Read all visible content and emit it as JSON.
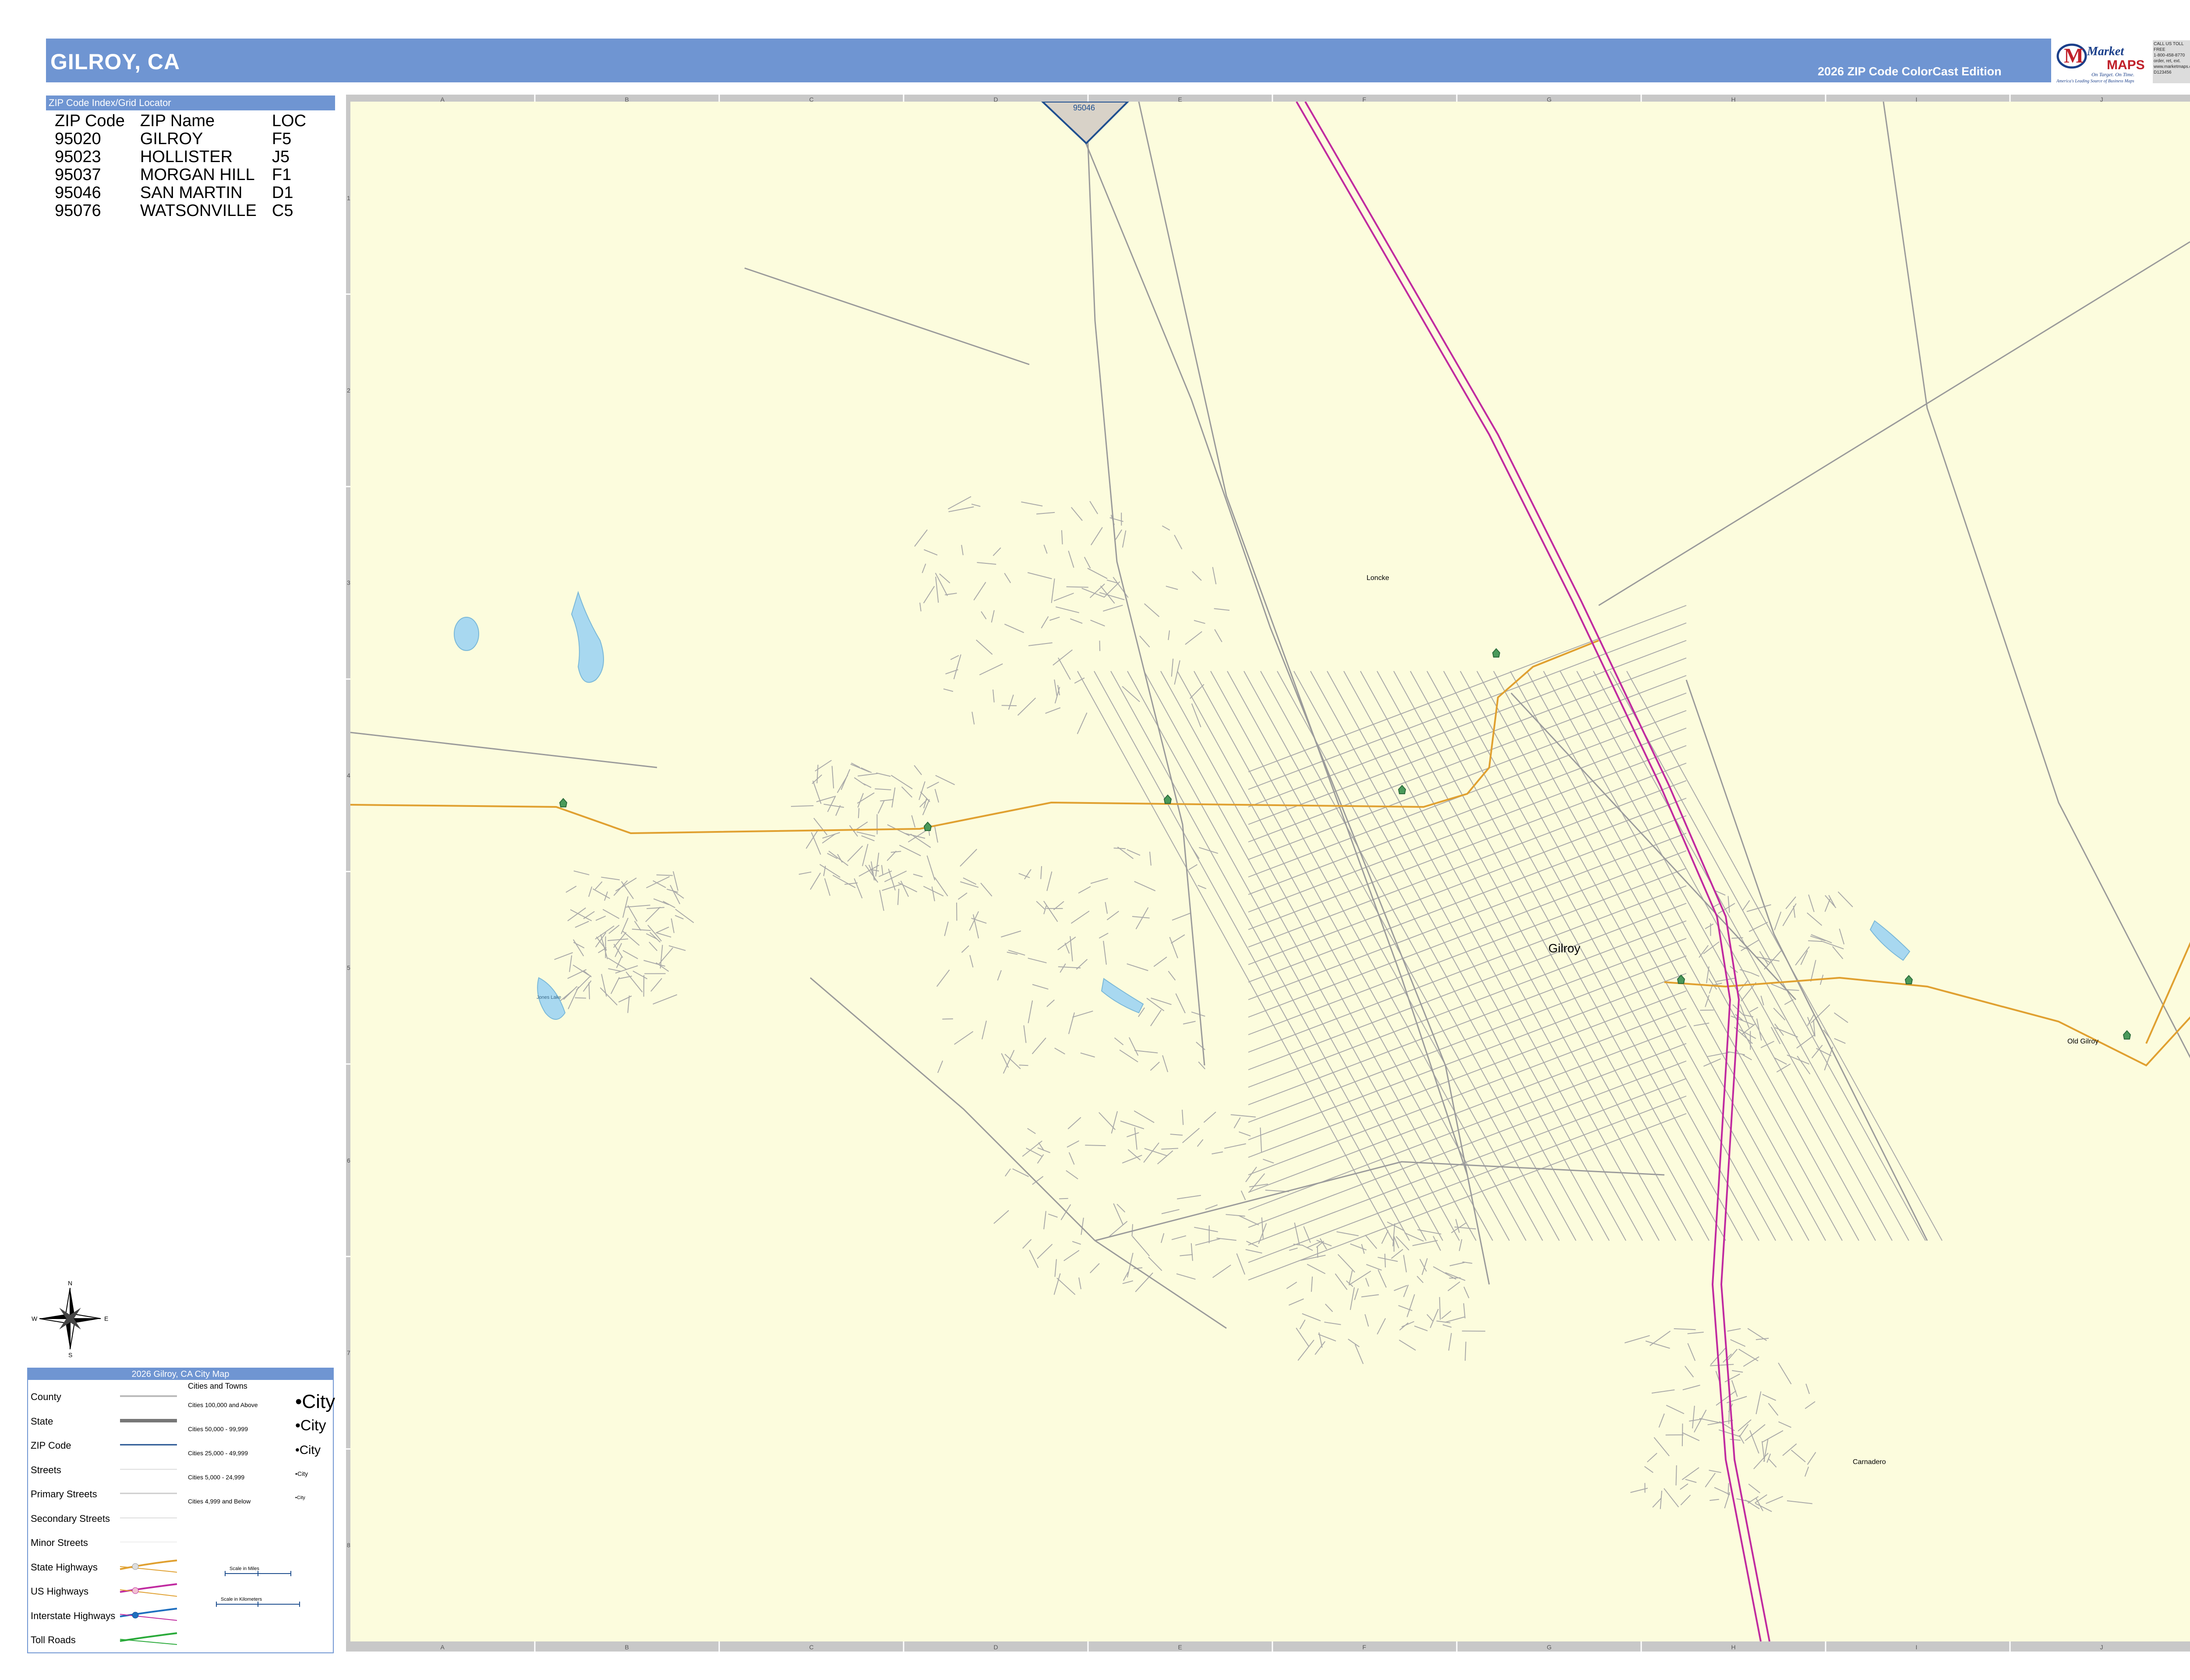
{
  "header": {
    "title": "GILROY, CA",
    "edition": "2026 ZIP Code ColorCast Edition",
    "logo_word": "Market",
    "logo_maps": "MAPS",
    "logo_tagline": "On Target. On Time.",
    "logo_subtagline": "America's Leading Source of Business Maps",
    "badge_lines": [
      "CALL US TOLL FREE",
      "1-800-458-8770",
      "order, ret, ext.",
      "www.marketmaps.com",
      "D123456"
    ]
  },
  "zip_index": {
    "header": "ZIP Code Index/Grid Locator",
    "columns": [
      "ZIP Code",
      "ZIP Name",
      "LOC"
    ],
    "rows": [
      [
        "95020",
        "GILROY",
        "F5"
      ],
      [
        "95023",
        "HOLLISTER",
        "J5"
      ],
      [
        "95037",
        "MORGAN HILL",
        "F1"
      ],
      [
        "95046",
        "SAN MARTIN",
        "D1"
      ],
      [
        "95076",
        "WATSONVILLE",
        "C5"
      ]
    ]
  },
  "map": {
    "grid_columns": [
      "A",
      "B",
      "C",
      "D",
      "E",
      "F",
      "G",
      "H",
      "I",
      "J"
    ],
    "grid_rows": [
      "1",
      "2",
      "3",
      "4",
      "5",
      "6",
      "7",
      "8"
    ],
    "zip_label": "95046",
    "place_labels": {
      "gilroy": "Gilroy",
      "loncke": "Loncke",
      "old_gilroy": "Old Gilroy",
      "carnadero": "Carnadero",
      "lake": "Jones Lake"
    },
    "colors": {
      "land": "#fcfcdd",
      "water": "#a8d8f0",
      "interstate": "#c02aa0",
      "state_highway": "#e0a030",
      "zip_boundary": "#1f4f8f",
      "streets": "#9a9a9a"
    }
  },
  "compass": {
    "n": "N",
    "s": "S",
    "e": "E",
    "w": "W"
  },
  "legend": {
    "title": "2026 Gilroy, CA City Map",
    "items": [
      "County",
      "State",
      "ZIP Code",
      "Streets",
      "Primary Streets",
      "Secondary Streets",
      "Minor Streets",
      "State Highways",
      "US Highways",
      "Interstate Highways",
      "Toll Roads"
    ],
    "cities_title": "Cities and Towns",
    "city_classes": [
      "Cities 100,000 and Above",
      "Cities 50,000 - 99,999",
      "Cities 25,000 - 49,999",
      "Cities 5,000 - 24,999",
      "Cities 4,999 and Below"
    ],
    "city_sample": "City",
    "scale_miles": "Scale in Miles",
    "scale_km": "Scale in Kilometers"
  }
}
